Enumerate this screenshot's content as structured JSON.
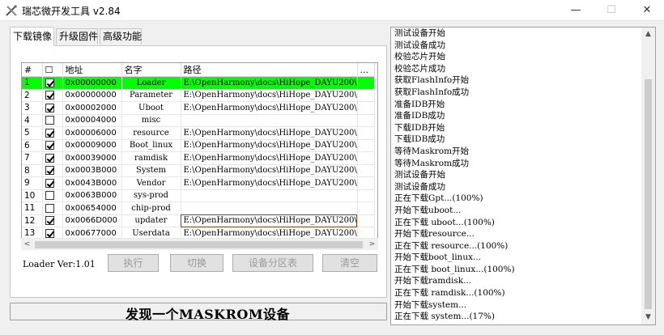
{
  "window": {
    "title": "瑞芯微开发工具 v2.84",
    "minimize": "—",
    "maximize": "☐",
    "close": "✕"
  },
  "tabs": [
    {
      "label": "下载镜像",
      "active": true
    },
    {
      "label": "升级固件",
      "active": false
    },
    {
      "label": "高级功能",
      "active": false
    }
  ],
  "table": {
    "headers": [
      "#",
      "☐",
      "地址",
      "名字",
      "路径",
      "..."
    ],
    "rows": [
      {
        "num": "1",
        "checked": true,
        "addr": "0x00000000",
        "name": "Loader",
        "path": "E:\\OpenHarmony\\docs\\HiHope_DAYU200\\...",
        "selected": true
      },
      {
        "num": "2",
        "checked": true,
        "addr": "0x00000000",
        "name": "Parameter",
        "path": "E:\\OpenHarmony\\docs\\HiHope_DAYU200\\..."
      },
      {
        "num": "3",
        "checked": true,
        "addr": "0x00002000",
        "name": "Uboot",
        "path": "E:\\OpenHarmony\\docs\\HiHope_DAYU200\\..."
      },
      {
        "num": "4",
        "checked": false,
        "addr": "0x00004000",
        "name": "misc",
        "path": ""
      },
      {
        "num": "5",
        "checked": true,
        "addr": "0x00006000",
        "name": "resource",
        "path": "E:\\OpenHarmony\\docs\\HiHope_DAYU200\\..."
      },
      {
        "num": "6",
        "checked": true,
        "addr": "0x00009000",
        "name": "Boot_linux",
        "path": "E:\\OpenHarmony\\docs\\HiHope_DAYU200\\..."
      },
      {
        "num": "7",
        "checked": true,
        "addr": "0x00039000",
        "name": "ramdisk",
        "path": "E:\\OpenHarmony\\docs\\HiHope_DAYU200\\..."
      },
      {
        "num": "8",
        "checked": true,
        "addr": "0x0003B000",
        "name": "System",
        "path": "E:\\OpenHarmony\\docs\\HiHope_DAYU200\\..."
      },
      {
        "num": "9",
        "checked": true,
        "addr": "0x0043B000",
        "name": "Vendor",
        "path": "E:\\OpenHarmony\\docs\\HiHope_DAYU200\\..."
      },
      {
        "num": "10",
        "checked": false,
        "addr": "0x0063B000",
        "name": "sys-prod",
        "path": ""
      },
      {
        "num": "11",
        "checked": false,
        "addr": "0x00654000",
        "name": "chip-prod",
        "path": ""
      },
      {
        "num": "12",
        "checked": true,
        "addr": "0x0066D000",
        "name": "updater",
        "path": "E:\\OpenHarmony\\docs\\HiHope_DAYU200\\...",
        "editing": true
      },
      {
        "num": "13",
        "checked": true,
        "addr": "0x00677000",
        "name": "Userdata",
        "path": "E:\\OpenHarmony\\docs\\HiHope_DAYU200\\..."
      }
    ]
  },
  "scroll": {
    "left_arrow": "<",
    "right_arrow": ">",
    "up_arrow": "▲",
    "down_arrow": "▼"
  },
  "loader_version": "Loader Ver:1.01",
  "buttons": {
    "run": "执行",
    "switch": "切换",
    "device_partition_table": "设备分区表",
    "clear": "清空"
  },
  "status": "发现一个MASKROM设备",
  "log": [
    "测试设备开始",
    "测试设备成功",
    "校验芯片开始",
    "校验芯片成功",
    "获取FlashInfo开始",
    "获取FlashInfo成功",
    "准备IDB开始",
    "准备IDB成功",
    "下载IDB开始",
    "下载IDB成功",
    "等待Maskrom开始",
    "等待Maskrom成功",
    "测试设备开始",
    "测试设备成功",
    "正在下载Gpt...(100%)",
    "开始下载uboot...",
    "正在下载 uboot...(100%)",
    "开始下载resource...",
    "正在下载 resource...(100%)",
    "开始下载boot_linux...",
    "正在下载 boot_linux...(100%)",
    "开始下载ramdisk...",
    "正在下载 ramdisk...(100%)",
    "开始下载system...",
    "正在下载 system...(17%)"
  ],
  "colors": {
    "selected_row": "#00ff00"
  }
}
